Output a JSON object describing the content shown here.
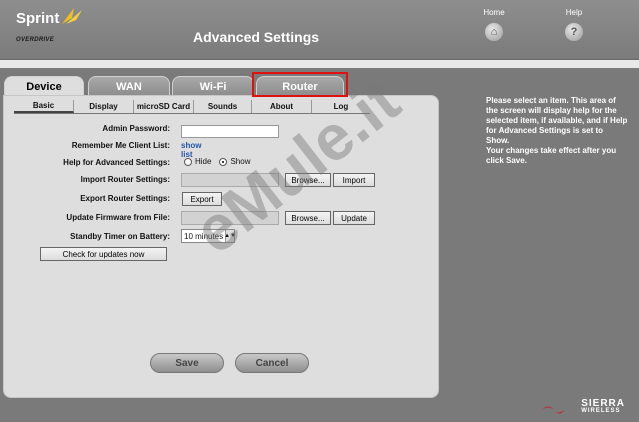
{
  "header": {
    "brand": "Sprint",
    "brand_sub": "OVERDRIVE",
    "title": "Advanced Settings",
    "home_label": "Home",
    "help_label": "Help",
    "home_icon": "house-icon",
    "help_icon": "question-icon"
  },
  "main_tabs": [
    {
      "label": "Device",
      "active": true
    },
    {
      "label": "WAN"
    },
    {
      "label": "Wi-Fi"
    },
    {
      "label": "Router",
      "highlighted": true
    }
  ],
  "sub_tabs": [
    {
      "label": "Basic",
      "active": true
    },
    {
      "label": "Display"
    },
    {
      "label": "microSD Card"
    },
    {
      "label": "Sounds"
    },
    {
      "label": "About"
    },
    {
      "label": "Log"
    }
  ],
  "form": {
    "admin_password_label": "Admin Password:",
    "remember_label": "Remember Me Client List:",
    "remember_link": "show list",
    "help_label": "Help for Advanced Settings:",
    "help_hide": "Hide",
    "help_show": "Show",
    "import_label": "Import Router Settings:",
    "browse_label": "Browse...",
    "import_btn": "Import",
    "export_label": "Export Router Settings:",
    "export_btn": "Export",
    "update_label": "Update Firmware from File:",
    "browse2_label": "Browse...",
    "update_btn": "Update",
    "standby_label": "Standby Timer on Battery:",
    "standby_value": "10 minutes",
    "check_updates_btn": "Check for updates now"
  },
  "actions": {
    "save": "Save",
    "cancel": "Cancel"
  },
  "help_text": {
    "p1": "Please select an item. This area of the screen will display help for the selected item, if available, and if Help for Advanced Settings is set to Show.",
    "p2": "Your changes take effect after you click Save."
  },
  "footer": {
    "brand": "SIERRA",
    "brand_sub": "WIRELESS"
  },
  "watermark": "eMule.it",
  "colors": {
    "highlight": "#e01010",
    "link": "#2255aa"
  }
}
